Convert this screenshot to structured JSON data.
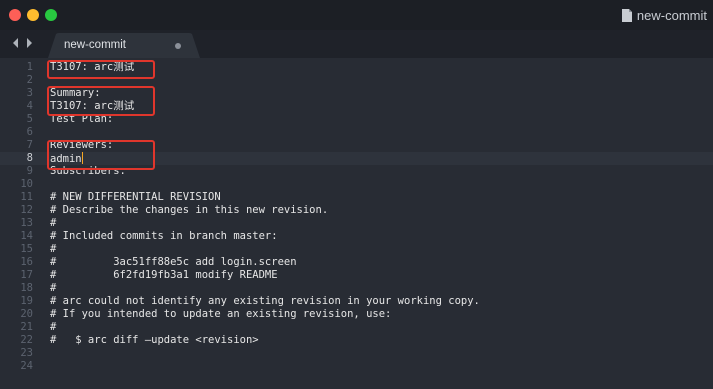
{
  "window": {
    "title": "new-commit"
  },
  "tab": {
    "label": "new-commit"
  },
  "colors": {
    "annotation": "#e0362c",
    "background": "#282c34",
    "caret": "#f5a623"
  },
  "editor": {
    "current_line": 8,
    "lines": [
      {
        "num": "1",
        "text": "T3107: arc测试"
      },
      {
        "num": "2",
        "text": ""
      },
      {
        "num": "3",
        "text": "Summary:"
      },
      {
        "num": "4",
        "text": "T3107: arc测试"
      },
      {
        "num": "5",
        "text": "Test Plan:"
      },
      {
        "num": "6",
        "text": ""
      },
      {
        "num": "7",
        "text": "Reviewers:"
      },
      {
        "num": "8",
        "text": "admin"
      },
      {
        "num": "9",
        "text": "Subscribers:"
      },
      {
        "num": "10",
        "text": ""
      },
      {
        "num": "11",
        "text": "# NEW DIFFERENTIAL REVISION"
      },
      {
        "num": "12",
        "text": "# Describe the changes in this new revision."
      },
      {
        "num": "13",
        "text": "#"
      },
      {
        "num": "14",
        "text": "# Included commits in branch master:"
      },
      {
        "num": "15",
        "text": "#"
      },
      {
        "num": "16",
        "text": "#         3ac51ff88e5c add login.screen"
      },
      {
        "num": "17",
        "text": "#         6f2fd19fb3a1 modify README"
      },
      {
        "num": "18",
        "text": "#"
      },
      {
        "num": "19",
        "text": "# arc could not identify any existing revision in your working copy."
      },
      {
        "num": "20",
        "text": "# If you intended to update an existing revision, use:"
      },
      {
        "num": "21",
        "text": "#"
      },
      {
        "num": "22",
        "text": "#   $ arc diff —update <revision>"
      },
      {
        "num": "23",
        "text": ""
      },
      {
        "num": "24",
        "text": ""
      }
    ]
  }
}
